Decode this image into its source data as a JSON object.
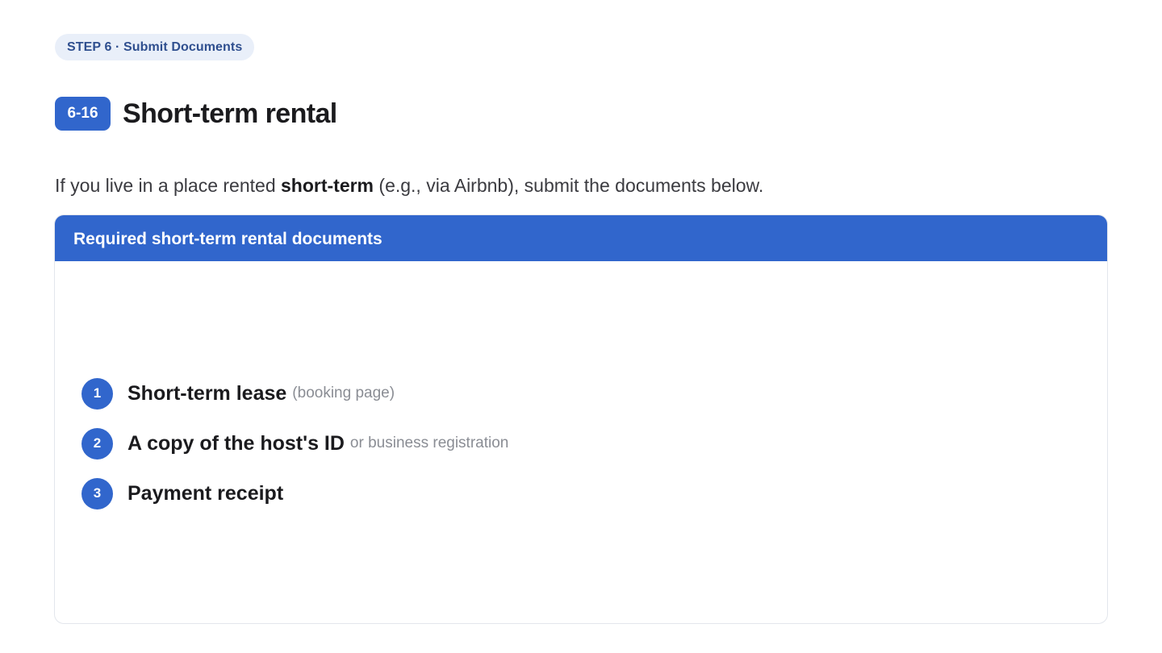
{
  "step": {
    "label": "STEP 6 · Submit Documents"
  },
  "section": {
    "code": "6-16",
    "title": "Short-term rental"
  },
  "intro": {
    "before": "If you live in a place rented ",
    "emphasis": "short-term",
    "after": " (e.g., via Airbnb), submit the documents below."
  },
  "card": {
    "header": "Required short-term rental documents",
    "items": [
      {
        "number": "1",
        "label": "Short-term lease",
        "note": "(booking page)"
      },
      {
        "number": "2",
        "label": "A copy of the host's ID",
        "note": "or business registration"
      },
      {
        "number": "3",
        "label": "Payment receipt",
        "note": ""
      }
    ]
  },
  "colors": {
    "accent": "#3166cc",
    "pill_bg": "#e9eff9",
    "pill_text": "#2f4f8f",
    "muted": "#8a8d94"
  }
}
